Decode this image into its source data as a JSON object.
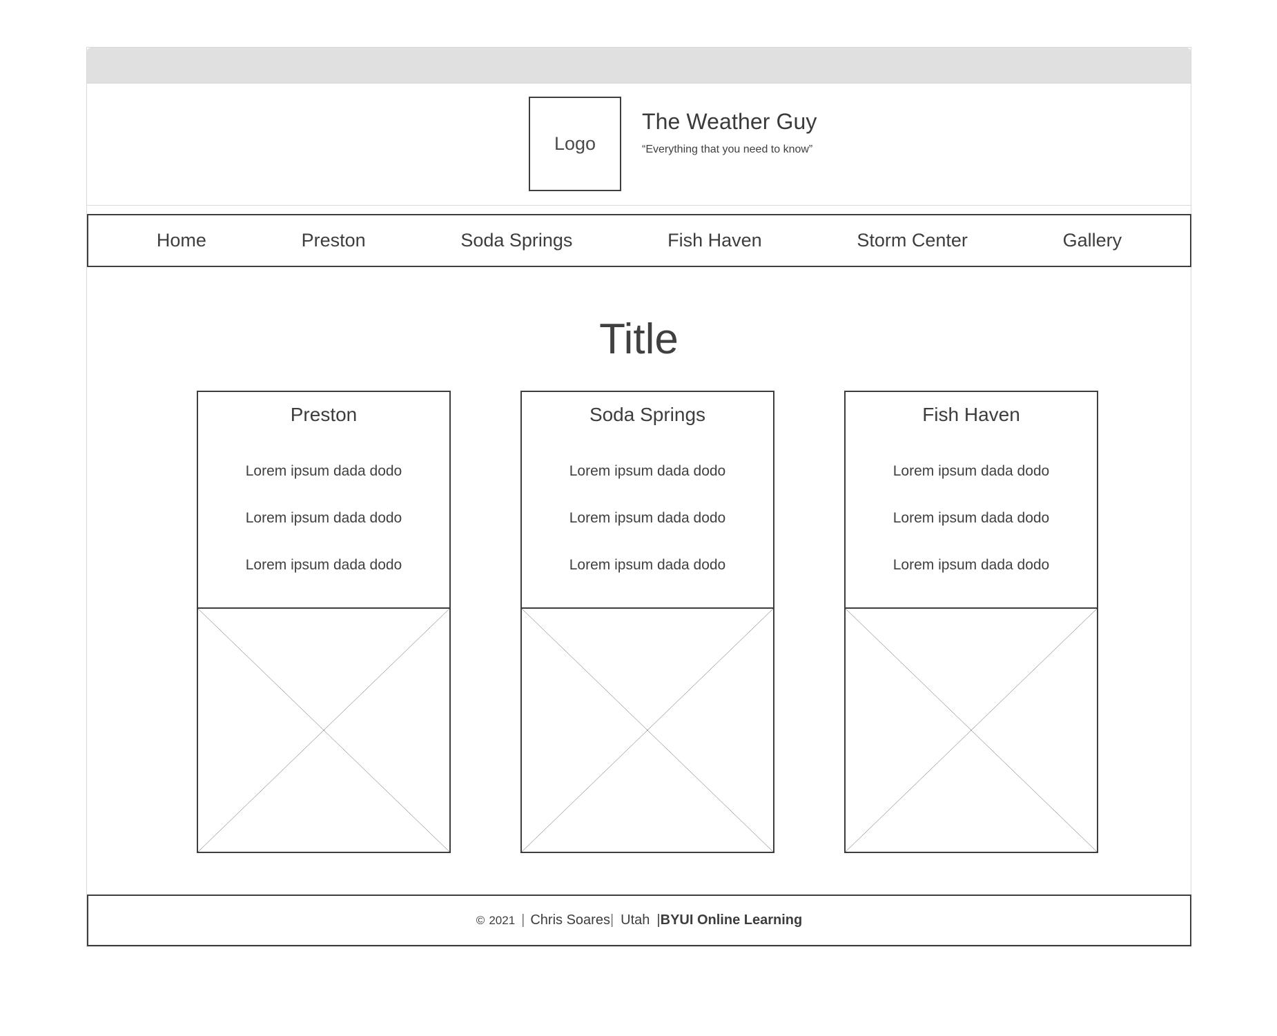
{
  "window": {
    "chrome_bar": "",
    "frame_border_color": "#d8d8d8",
    "chrome_color": "#e0e0e0"
  },
  "header": {
    "logo_label": "Logo",
    "title": "The Weather Guy",
    "tagline": "“Everything that you need to know”"
  },
  "nav": {
    "items": [
      {
        "label": "Home"
      },
      {
        "label": "Preston"
      },
      {
        "label": "Soda Springs"
      },
      {
        "label": "Fish Haven"
      },
      {
        "label": "Storm Center"
      },
      {
        "label": "Gallery"
      }
    ]
  },
  "main": {
    "title": "Title",
    "cards": [
      {
        "title": "Preston",
        "lines": [
          "Lorem ipsum dada dodo",
          "Lorem ipsum dada dodo",
          "Lorem ipsum dada dodo"
        ],
        "image_placeholder": "image-placeholder"
      },
      {
        "title": "Soda Springs",
        "lines": [
          "Lorem ipsum dada dodo",
          "Lorem ipsum dada dodo",
          "Lorem ipsum dada dodo"
        ],
        "image_placeholder": "image-placeholder"
      },
      {
        "title": "Fish Haven",
        "lines": [
          "Lorem ipsum dada dodo",
          "Lorem ipsum dada dodo",
          "Lorem ipsum dada dodo"
        ],
        "image_placeholder": "image-placeholder"
      }
    ]
  },
  "footer": {
    "copyright_symbol": "©",
    "year": "2021",
    "separator1": "|",
    "author": "Chris Soares",
    "separator2": "|",
    "location": "Utah",
    "separator3": "|",
    "organization": "BYUI Online Learning"
  }
}
